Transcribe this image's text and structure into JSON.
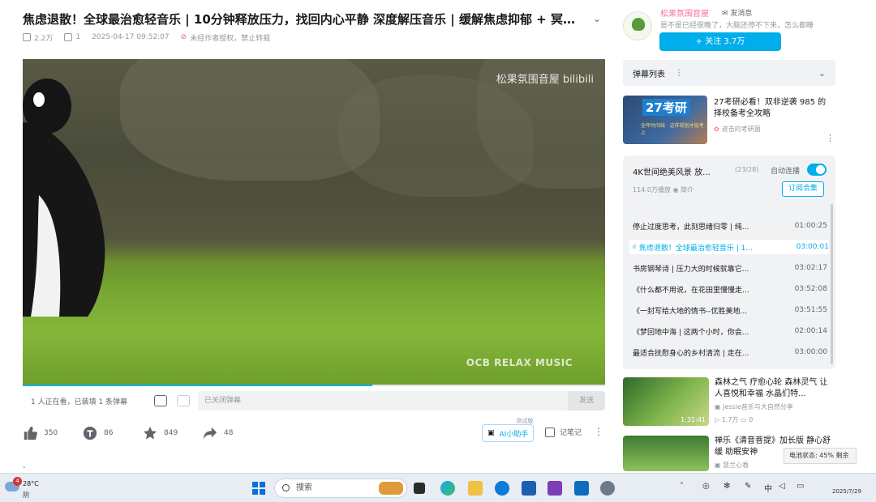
{
  "video": {
    "title": "焦虑退散！全球最治愈轻音乐 | 10分钟释放压力，找回内心平静 深度解压音乐 | 缓解焦虑抑郁 + 冥想放...",
    "views": "2.2万",
    "danmaku_count": "1",
    "date": "2025-04-17 09:52:07",
    "copyright": "未经作者授权，禁止转载",
    "watermark": "松果氛围音屋 bilibili",
    "watermark_bottom": "OCB RELAX MUSIC",
    "progress": 0.6
  },
  "danmaku_bar": {
    "viewers": "1 人正在看，已装填 1 条弹幕",
    "placeholder": "已关闭弹幕",
    "send_label": "发送"
  },
  "actions": {
    "like": "350",
    "coin": "86",
    "favorite": "849",
    "share": "48",
    "ai_label": "AI小助手",
    "ai_tag": "测试版",
    "notes_label": "记笔记",
    "more": "⋮"
  },
  "uploader": {
    "name": "松果氛围音屋",
    "message_label": "发消息",
    "bio": "是不是已经很晚了，大脑还停不下来，怎么都睡",
    "follow_label": "+ 关注 3.7万"
  },
  "danmaku_list": {
    "label": "弹幕列表",
    "dots": "⋮"
  },
  "ad": {
    "title": "27考研必看！双非逆袭 985 的择校备考全攻略",
    "source": "进击的考研菌",
    "thumb_big": "27考研",
    "thumb_small": "全年时间线 · 这样规划才能考上"
  },
  "collection": {
    "title": "4K世间绝美风景 放...",
    "count": "(23/28)",
    "autoplay_label": "自动连播",
    "stats": "114.0万播放",
    "intro_label": "简介",
    "subscribe_label": "订阅合集",
    "episodes": [
      {
        "title": "停止过度思考，此刻思绪归零 | 纯...",
        "duration": "01:00:25"
      },
      {
        "title": "焦虑退散！全球最治愈轻音乐 | 1...",
        "duration": "03:00:01"
      },
      {
        "title": "书房钢琴诗 | 压力大的时候就靠它...",
        "duration": "03:02:17"
      },
      {
        "title": "《什么都不用说，在花田里慢慢走...",
        "duration": "03:52:08"
      },
      {
        "title": "《一封写给大地的情书--优胜美地...",
        "duration": "03:51:55"
      },
      {
        "title": "《梦回地中海 | 这两个小时，你会...",
        "duration": "02:00:14"
      },
      {
        "title": "最适合抚慰身心的乡村清流 | 走在...",
        "duration": "03:00:00"
      }
    ]
  },
  "recommended": [
    {
      "title": "森林之气 疗愈心轮 森林灵气 让人喜悦和幸福 水晶们特...",
      "author": "Jessie音乐与大自然分享",
      "views": "1.7万",
      "comments": "0",
      "duration": "1:31:41"
    },
    {
      "title": "禅乐《清音菩提》加长版 静心舒缓 助眠安神",
      "author": "慧兰心香",
      "views": "",
      "comments": "",
      "duration": ""
    }
  ],
  "battery_tip": "电池状态: 45% 剩余",
  "taskbar": {
    "temp": "28°C",
    "weather": "阴",
    "notifications": "4",
    "search_label": "搜索",
    "ime": "中",
    "date": "2025/7/29"
  }
}
